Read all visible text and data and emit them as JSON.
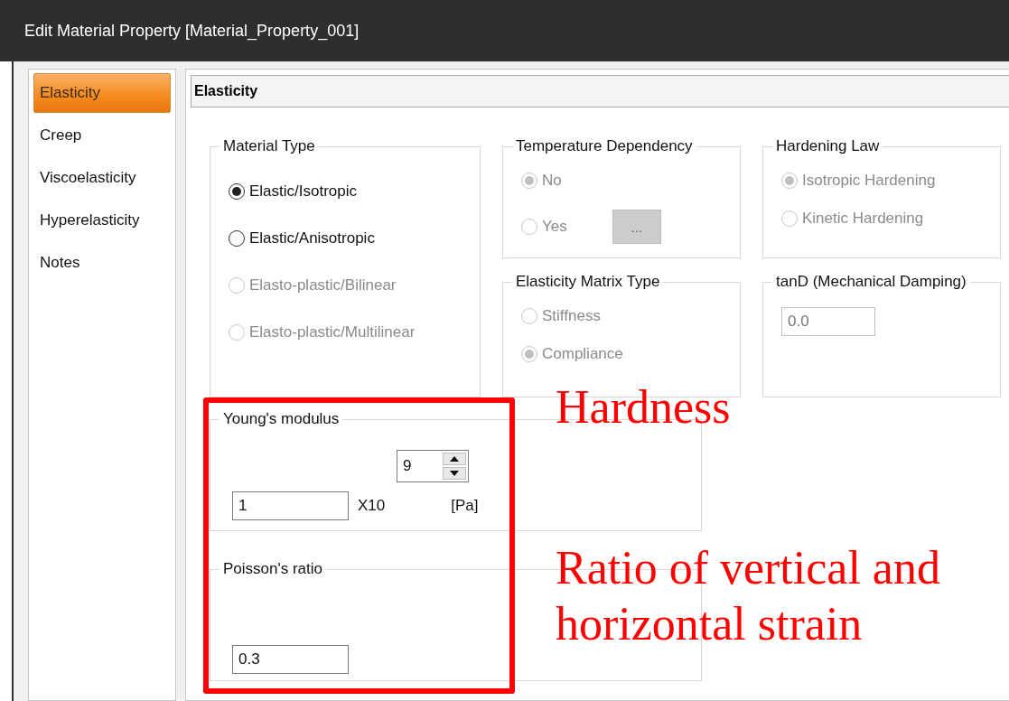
{
  "window": {
    "title": "Edit Material Property [Material_Property_001]"
  },
  "sidebar": {
    "items": [
      {
        "label": "Elasticity",
        "selected": true
      },
      {
        "label": "Creep",
        "selected": false
      },
      {
        "label": "Viscoelasticity",
        "selected": false
      },
      {
        "label": "Hyperelasticity",
        "selected": false
      },
      {
        "label": "Notes",
        "selected": false
      }
    ]
  },
  "panel": {
    "header": "Elasticity"
  },
  "material_type": {
    "title": "Material Type",
    "options": [
      {
        "label": "Elastic/Isotropic",
        "selected": true,
        "disabled": false
      },
      {
        "label": "Elastic/Anisotropic",
        "selected": false,
        "disabled": false
      },
      {
        "label": "Elasto-plastic/Bilinear",
        "selected": false,
        "disabled": true
      },
      {
        "label": "Elasto-plastic/Multilinear",
        "selected": false,
        "disabled": true
      }
    ]
  },
  "temperature_dependency": {
    "title": "Temperature Dependency",
    "options": [
      {
        "label": "No",
        "selected": true,
        "disabled": true
      },
      {
        "label": "Yes",
        "selected": false,
        "disabled": true
      }
    ],
    "button": {
      "label": "...",
      "disabled": true
    }
  },
  "hardening_law": {
    "title": "Hardening Law",
    "options": [
      {
        "label": "Isotropic Hardening",
        "selected": true,
        "disabled": true
      },
      {
        "label": "Kinetic Hardening",
        "selected": false,
        "disabled": true
      }
    ]
  },
  "elasticity_matrix_type": {
    "title": "Elasticity Matrix Type",
    "options": [
      {
        "label": "Stiffness",
        "selected": false,
        "disabled": true
      },
      {
        "label": "Compliance",
        "selected": true,
        "disabled": true
      }
    ]
  },
  "tand": {
    "title": "tanD (Mechanical Damping)",
    "value": "0.0",
    "disabled": true
  },
  "youngs_modulus": {
    "title": "Young's modulus",
    "value": "1",
    "multiplier": "X10",
    "exponent": "9",
    "unit": "[Pa]"
  },
  "poissons_ratio": {
    "title": "Poisson's ratio",
    "value": "0.3"
  },
  "annotations": [
    {
      "text": "Hardness"
    },
    {
      "text": "Ratio of vertical and horizontal strain"
    }
  ]
}
